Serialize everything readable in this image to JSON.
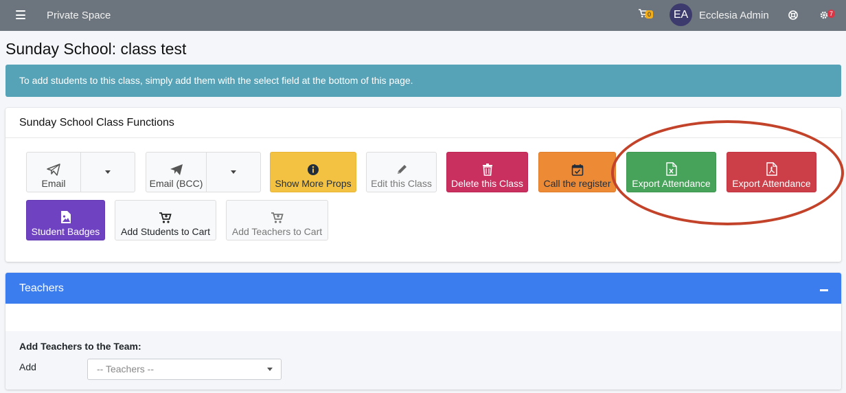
{
  "navbar": {
    "space_title": "Private Space",
    "cart_count": "0",
    "avatar_initials": "EA",
    "user_name": "Ecclesia Admin",
    "notifications_count": "7"
  },
  "page_title": "Sunday School: class test",
  "info_banner": "To add students to this class, simply add them with the select field at the bottom of this page.",
  "functions": {
    "header": "Sunday School Class Functions",
    "buttons": {
      "email": "Email",
      "email_bcc": "Email (BCC)",
      "show_more_props": "Show More Props",
      "edit_class": "Edit this Class",
      "delete_class": "Delete this Class",
      "call_register": "Call the register",
      "export_excel": "Export Attendance",
      "export_pdf": "Export Attendance",
      "student_badges": "Student Badges",
      "add_students_cart": "Add Students to Cart",
      "add_teachers_cart": "Add Teachers to Cart"
    }
  },
  "teachers": {
    "header": "Teachers",
    "add_title": "Add Teachers to the Team:",
    "add_label": "Add",
    "select_placeholder": "-- Teachers --"
  },
  "colors": {
    "navbar": "#6c757d",
    "banner": "#56a3b7",
    "teachers_header": "#3b7dee",
    "annotation": "#c2432a"
  }
}
